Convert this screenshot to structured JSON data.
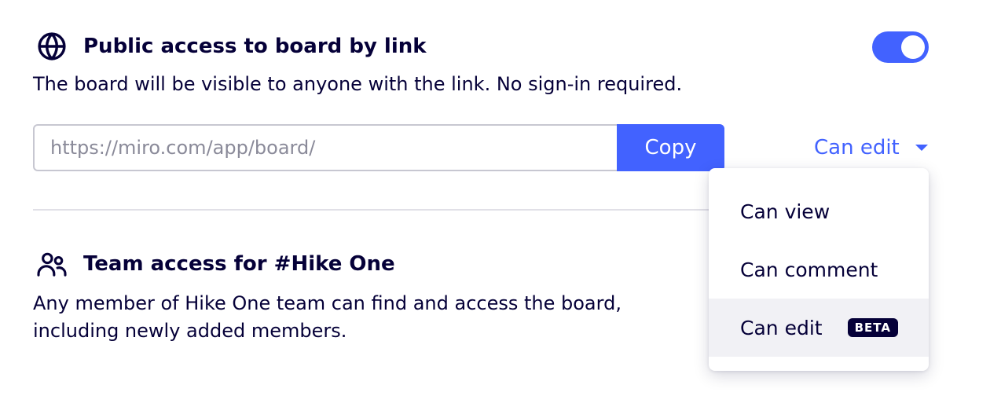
{
  "public_access": {
    "title": "Public access to board by link",
    "description": "The board will be visible to anyone with the link. No sign-in required.",
    "icon": "globe-icon",
    "toggle_on": true,
    "link_value": "https://miro.com/app/board/",
    "copy_label": "Copy",
    "permission_selected": "Can edit"
  },
  "team_access": {
    "title": "Team access for #Hike One",
    "description": "Any member of Hike One team can find and access the board, including newly added members.",
    "icon": "users-icon"
  },
  "permission_menu": {
    "items": [
      {
        "label": "Can view"
      },
      {
        "label": "Can comment"
      },
      {
        "label": "Can edit",
        "badge": "BETA",
        "selected": true
      }
    ]
  },
  "colors": {
    "accent": "#4262ff",
    "text": "#050038",
    "selected_bg": "#f1f1f5"
  }
}
